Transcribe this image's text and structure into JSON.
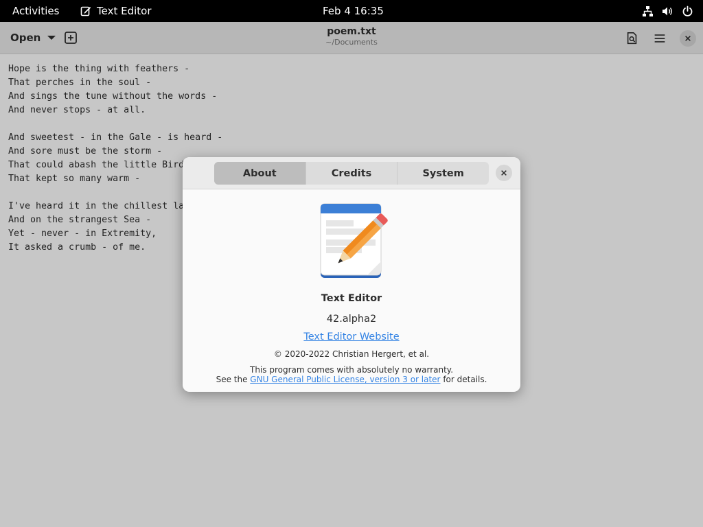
{
  "topbar": {
    "activities": "Activities",
    "app_name": "Text Editor",
    "clock": "Feb 4  16:35",
    "tray_icons": [
      "network-icon",
      "volume-icon",
      "power-icon"
    ]
  },
  "window": {
    "open_label": "Open",
    "title": "poem.txt",
    "subtitle": "~/Documents",
    "editor_lines": [
      "Hope is the thing with feathers -",
      "That perches in the soul -",
      "And sings the tune without the words -",
      "And never stops - at all.",
      "",
      "And sweetest - in the Gale - is heard -",
      "And sore must be the storm -",
      "That could abash the little Bird",
      "That kept so many warm -",
      "",
      "I've heard it in the chillest la",
      "And on the strangest Sea -",
      "Yet - never - in Extremity,",
      "It asked a crumb - of me."
    ]
  },
  "dialog": {
    "tabs": [
      {
        "label": "About",
        "active": true
      },
      {
        "label": "Credits",
        "active": false
      },
      {
        "label": "System",
        "active": false
      }
    ],
    "app_name": "Text Editor",
    "version": "42.alpha2",
    "website": "Text Editor Website",
    "copyright": "© 2020-2022 Christian Hergert, et al.",
    "warranty": "This program comes with absolutely no warranty.",
    "license_prefix": "See the ",
    "license_link": "GNU General Public License, version 3 or later",
    "license_suffix": " for details."
  },
  "colors": {
    "accent": "#3584e4",
    "topbar_bg": "#000000",
    "headerbar_bg": "#ebebeb",
    "icon_blue": "#3c7fd6",
    "pencil_orange": "#f08a1e",
    "eraser_red": "#e85a58"
  }
}
